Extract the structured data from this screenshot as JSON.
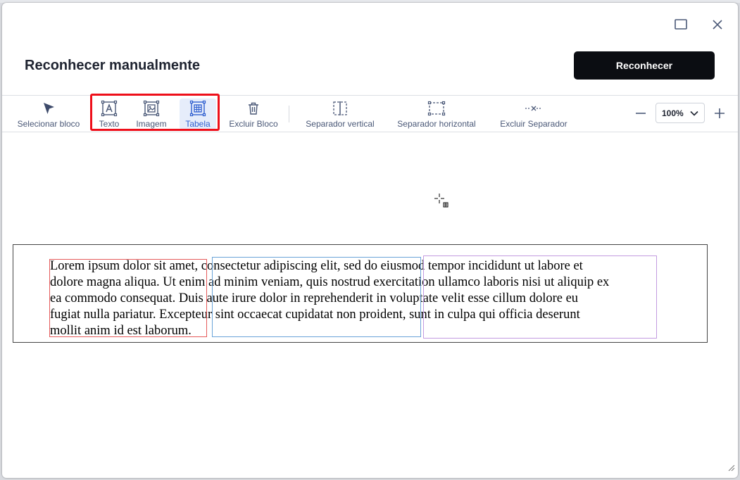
{
  "window": {
    "title": "Reconhecer manualmente",
    "primary_button": "Reconhecer"
  },
  "toolbar": {
    "tools": {
      "select": "Selecionar bloco",
      "text": "Texto",
      "image": "Imagem",
      "table": "Tabela",
      "delete_block": "Excluir Bloco",
      "vertical_separator": "Separador vertical",
      "horizontal_separator": "Separador horizontal",
      "delete_separator": "Excluir Separador"
    },
    "active_tool": "Tabela",
    "zoom": {
      "value": "100%"
    }
  },
  "document": {
    "line1": "Lorem ipsum dolor sit amet, consectetur adipiscing elit, sed do eiusmod tempor incididunt ut labore et",
    "line2": "dolore magna aliqua. Ut enim ad minim veniam, quis nostrud exercitation ullamco laboris nisi ut aliquip ex",
    "line3": "ea commodo consequat. Duis aute irure dolor in reprehenderit in voluptate velit esse cillum dolore eu",
    "line4": "fugiat nulla pariatur. Excepteur sint occaecat cupidatat non proident, sunt in culpa qui officia deserunt",
    "line5": "mollit anim id est laborum."
  },
  "colors": {
    "primary_button": "#0b0d12",
    "highlight": "#ee0f1a",
    "active_tool_text": "#2f5fd0",
    "block_red": "#e55a5a",
    "block_blue": "#6aa3d8",
    "block_purple": "#c39be0"
  },
  "icons": [
    "maximize-icon",
    "close-icon",
    "select-cursor-icon",
    "text-block-icon",
    "image-block-icon",
    "table-block-icon",
    "trash-icon",
    "vertical-separator-icon",
    "horizontal-separator-icon",
    "delete-separator-icon",
    "minus-icon",
    "plus-icon",
    "chevron-down-icon",
    "crosshair-cursor-icon",
    "resize-grip-icon"
  ]
}
